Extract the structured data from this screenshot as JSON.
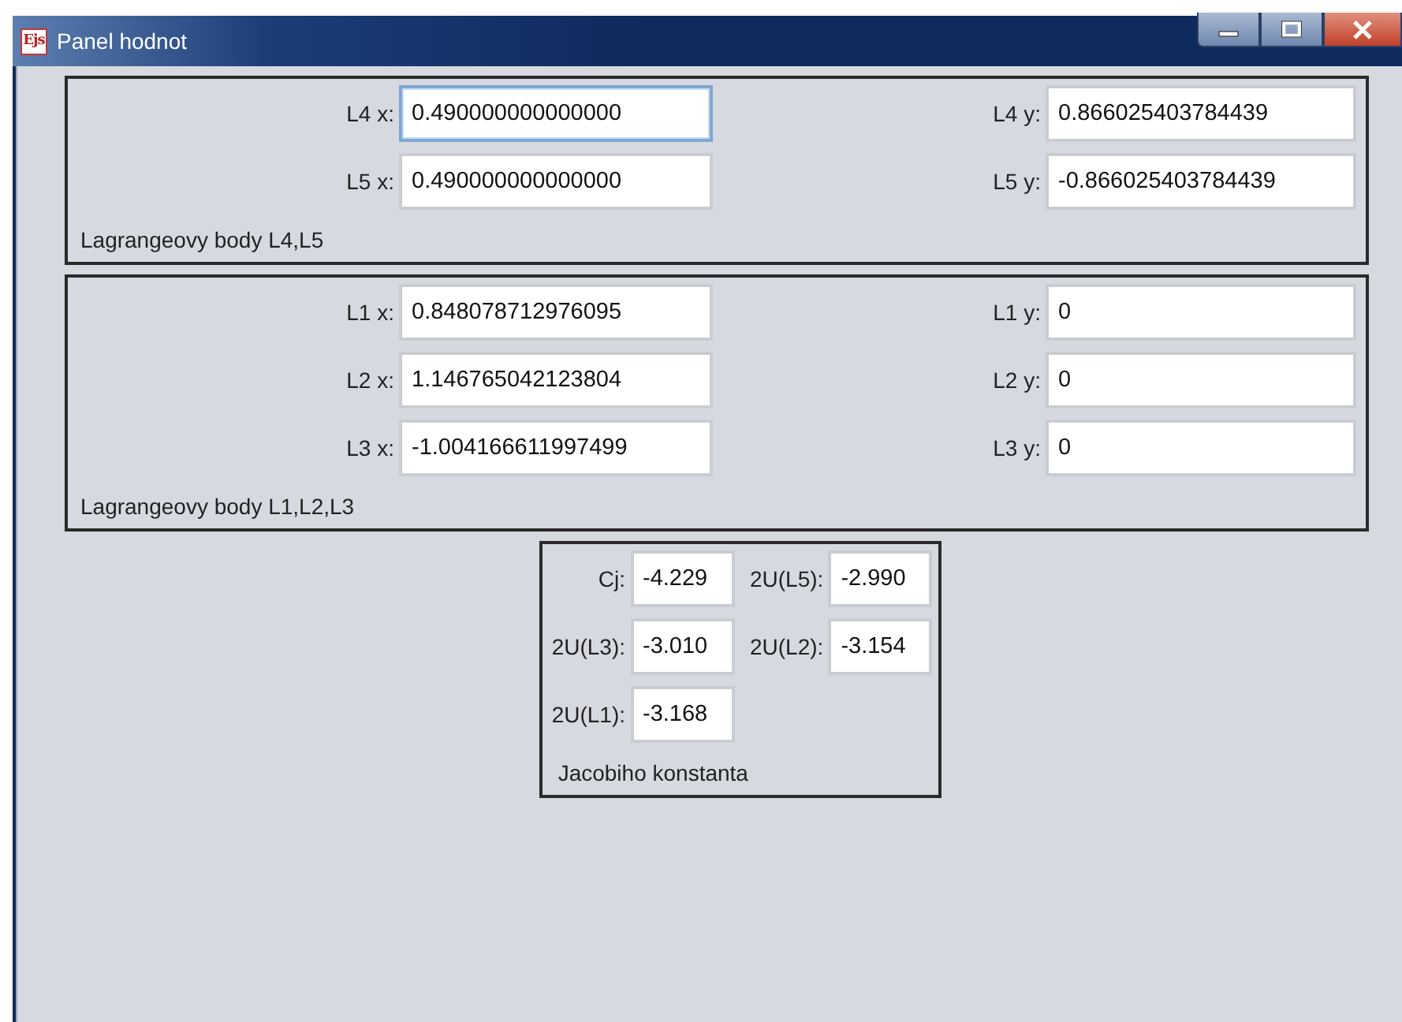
{
  "window": {
    "title": "Panel hodnot",
    "app_icon": "Ejs",
    "controls": [
      {
        "kind": "minimize"
      },
      {
        "kind": "maximize"
      },
      {
        "kind": "close"
      }
    ]
  },
  "groups": [
    {
      "kind": "pairs",
      "caption": "Lagrangeovy body L4,L5",
      "rows": [
        {
          "x_label": "L4 x:",
          "x_value": "0.490000000000000",
          "x_focused": true,
          "y_label": "L4 y:",
          "y_value": "0.866025403784439",
          "y_focused": false
        },
        {
          "x_label": "L5 x:",
          "x_value": "0.490000000000000",
          "x_focused": false,
          "y_label": "L5 y:",
          "y_value": "-0.866025403784439",
          "y_focused": false
        }
      ]
    },
    {
      "kind": "pairs",
      "caption": "Lagrangeovy body L1,L2,L3",
      "rows": [
        {
          "x_label": "L1 x:",
          "x_value": "0.848078712976095",
          "x_focused": false,
          "y_label": "L1 y:",
          "y_value": "0",
          "y_focused": false
        },
        {
          "x_label": "L2 x:",
          "x_value": "1.146765042123804",
          "x_focused": false,
          "y_label": "L2 y:",
          "y_value": "0",
          "y_focused": false
        },
        {
          "x_label": "L3 x:",
          "x_value": "-1.004166611997499",
          "x_focused": false,
          "y_label": "L3 y:",
          "y_value": "0",
          "y_focused": false
        }
      ]
    },
    {
      "kind": "compact",
      "caption": "Jacobiho konstanta",
      "fields": [
        {
          "label": "Cj:",
          "value": "-4.229"
        },
        {
          "label": "2U(L5):",
          "value": "-2.990"
        },
        {
          "label": "2U(L3):",
          "value": "-3.010"
        },
        {
          "label": "2U(L2):",
          "value": "-3.154"
        },
        {
          "label": "2U(L1):",
          "value": "-3.168"
        }
      ]
    }
  ]
}
